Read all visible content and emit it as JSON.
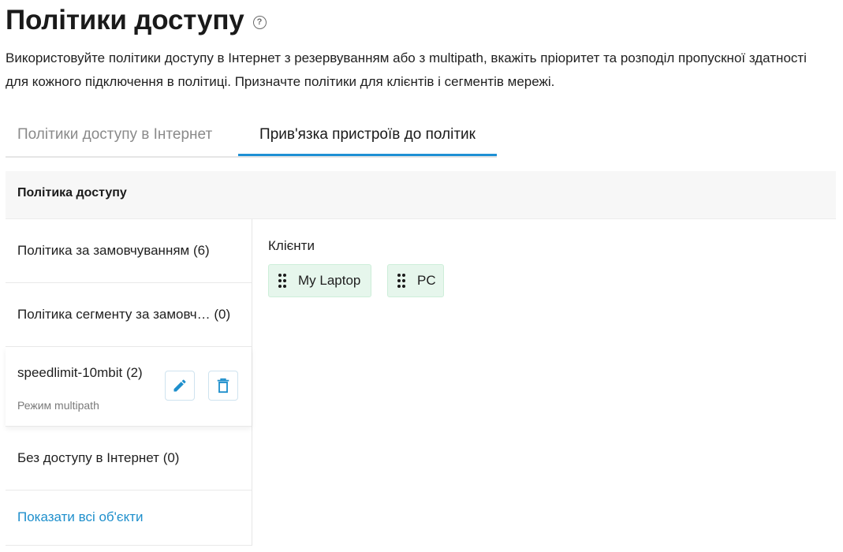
{
  "page": {
    "title": "Політики доступу",
    "help_icon": "question-circle-icon",
    "description": "Використовуйте політики доступу в Інтернет з резервуванням або з multipath, вкажіть пріоритет та розподіл пропускної здатності для кожного підключення в політиці. Призначте політики для клієнтів і сегментів мережі."
  },
  "tabs": [
    {
      "label": "Політики доступу в Інтернет",
      "active": false
    },
    {
      "label": "Прив'язка пристроїв до політик",
      "active": true
    }
  ],
  "colors": {
    "accent": "#1e90d4",
    "link": "#1e8fcc",
    "chip_bg": "#e6f6ec"
  },
  "table": {
    "header": "Політика доступу"
  },
  "policies": [
    {
      "name": "Політика за замовчуванням (6)"
    },
    {
      "name": "Політика сегменту за замовч…  (0)"
    },
    {
      "name": "speedlimit-10mbit (2)",
      "mode": "Режим multipath",
      "edit_icon": "pencil-icon",
      "delete_icon": "trash-icon"
    },
    {
      "name": "Без доступу в Інтернет (0)"
    }
  ],
  "show_all": "Показати всі об'єкти",
  "clients": {
    "label": "Клієнти",
    "items": [
      {
        "label": "My Laptop",
        "icon": "drag-handle-icon"
      },
      {
        "label": "PC",
        "icon": "drag-handle-icon"
      }
    ]
  }
}
